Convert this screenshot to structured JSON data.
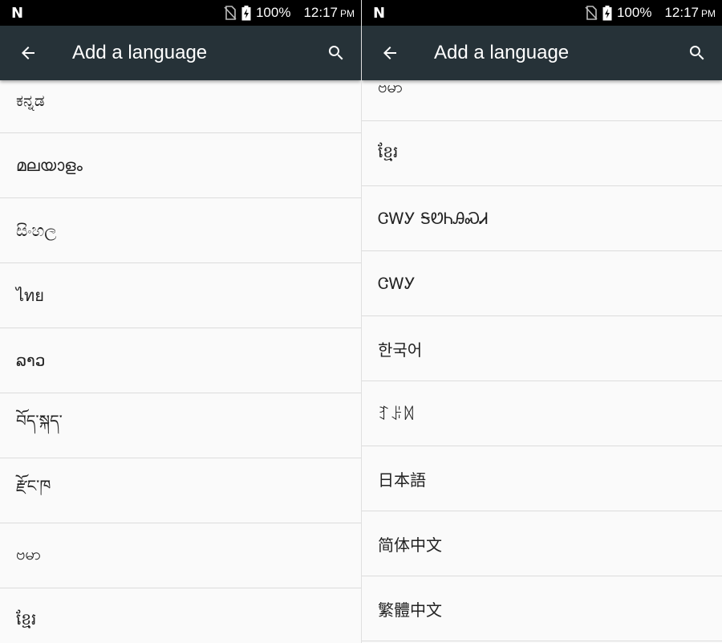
{
  "status": {
    "notif_icon": "N",
    "battery": "100%",
    "time": "12:17",
    "ampm": "PM"
  },
  "icons": {
    "back": "arrow-back-icon",
    "search": "search-icon",
    "no_sim": "no-sim-icon",
    "battery": "battery-charging-icon"
  },
  "colors": {
    "appbar": "#263238",
    "statusbar": "#000000",
    "list_bg": "#fafafa",
    "divider": "#dcdcdc"
  },
  "left": {
    "title": "Add a language",
    "items": [
      {
        "label": "ಕನ್ನಡ"
      },
      {
        "label": "മലയാളം"
      },
      {
        "label": "සිංහල"
      },
      {
        "label": "ไทย"
      },
      {
        "label": "ລາວ"
      },
      {
        "label": "བོད་སྐད་"
      },
      {
        "label": "རྫོང་ཁ"
      },
      {
        "label": "ဗမာ"
      },
      {
        "label": "ខ្មែរ"
      }
    ]
  },
  "right": {
    "title": "Add a language",
    "items": [
      {
        "label": "ဗမာ"
      },
      {
        "label": "ខ្មែរ"
      },
      {
        "label": "ᏣᎳᎩ ᎦᏬᏂᎯᏍᏗ"
      },
      {
        "label": "ᏣᎳᎩ"
      },
      {
        "label": "한국어"
      },
      {
        "label": "ꆈꌠꉙ"
      },
      {
        "label": "日本語"
      },
      {
        "label": "简体中文"
      },
      {
        "label": "繁體中文"
      }
    ]
  }
}
